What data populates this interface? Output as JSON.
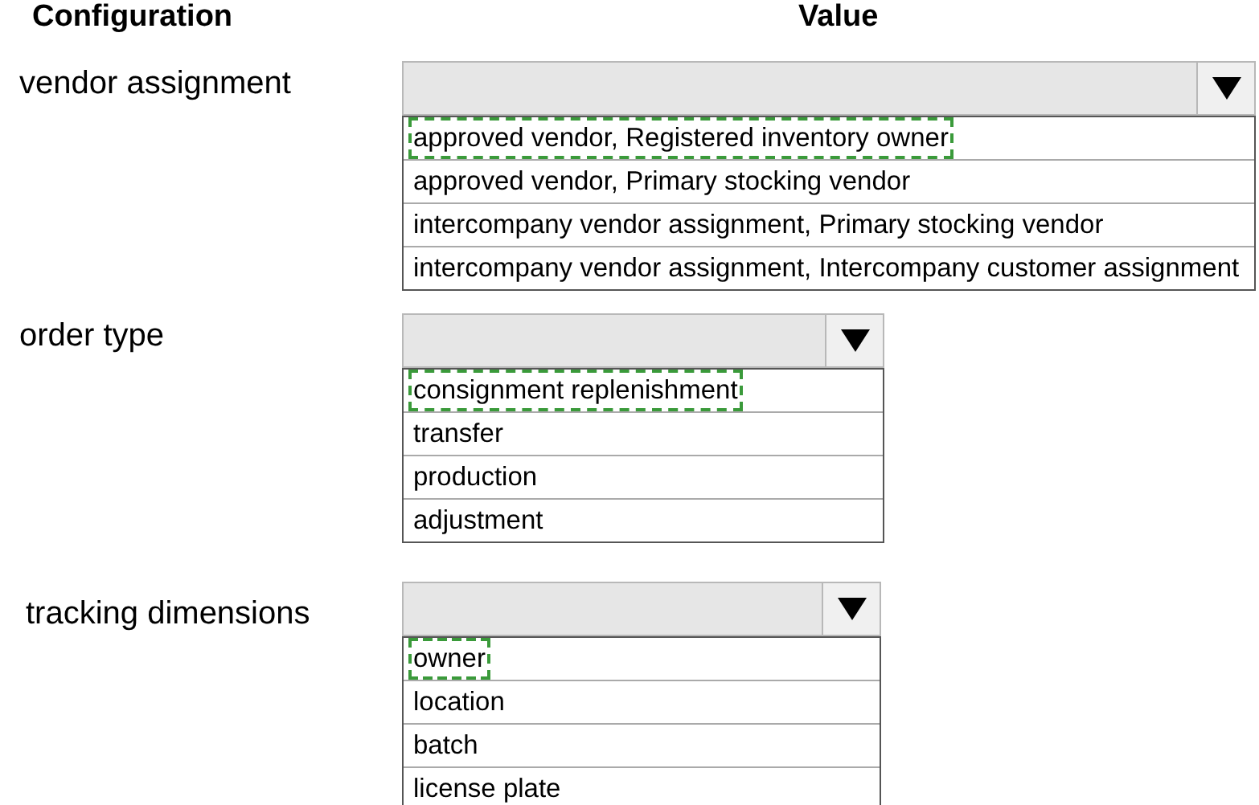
{
  "headers": [
    "Configuration",
    "Value"
  ],
  "rows": [
    {
      "label": "vendor assignment",
      "options": [
        {
          "text": "approved vendor, Registered inventory owner",
          "selected": true
        },
        {
          "text": "approved vendor, Primary stocking vendor",
          "selected": false
        },
        {
          "text": "intercompany vendor assignment, Primary stocking vendor",
          "selected": false
        },
        {
          "text": "intercompany vendor assignment, Intercompany customer assignment",
          "selected": false
        }
      ]
    },
    {
      "label": "order type",
      "options": [
        {
          "text": "consignment replenishment",
          "selected": true
        },
        {
          "text": "transfer",
          "selected": false
        },
        {
          "text": "production",
          "selected": false
        },
        {
          "text": "adjustment",
          "selected": false
        }
      ]
    },
    {
      "label": "tracking dimensions",
      "options": [
        {
          "text": "owner",
          "selected": true
        },
        {
          "text": "location",
          "selected": false
        },
        {
          "text": "batch",
          "selected": false
        },
        {
          "text": "license plate",
          "selected": false
        }
      ]
    }
  ]
}
